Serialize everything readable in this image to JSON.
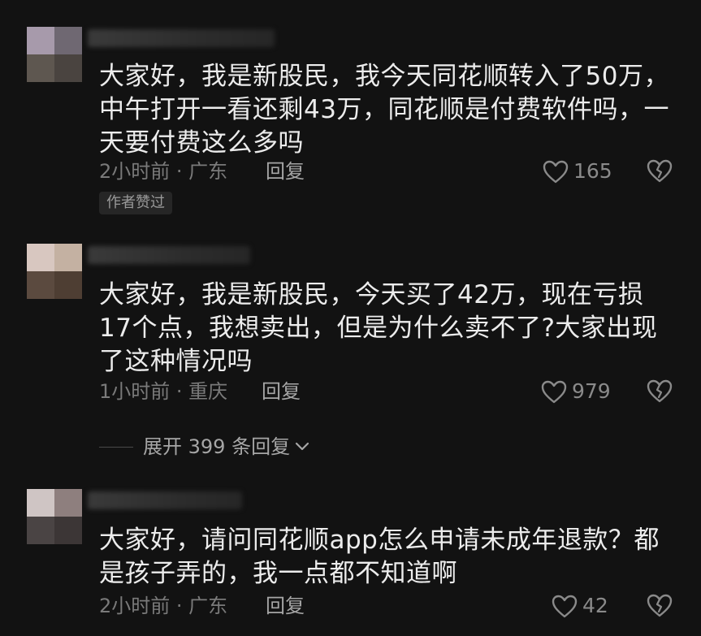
{
  "comments": [
    {
      "text": "大家好，我是新股民，我今天同花顺转入了50万，中午打开一看还剩43万，同花顺是付费软件吗，一天要付费这么多吗",
      "time_location": "2小时前 · 广东",
      "reply_label": "回复",
      "likes": "165",
      "badge": "作者赞过"
    },
    {
      "text": "大家好，我是新股民，今天买了42万，现在亏损17个点，我想卖出，但是为什么卖不了?大家出现了这种情况吗",
      "time_location": "1小时前 · 重庆",
      "reply_label": "回复",
      "likes": "979"
    },
    {
      "text": "大家好，请问同花顺app怎么申请未成年退款？都是孩子弄的，我一点都不知道啊",
      "time_location": "2小时前 · 广东",
      "reply_label": "回复",
      "likes": "42"
    }
  ],
  "expand_replies": {
    "label": "展开 399 条回复"
  },
  "icons": {
    "like": "heart-outline-icon",
    "dislike": "broken-heart-icon",
    "expand": "chevron-down-icon"
  },
  "colors": {
    "background": "#121212",
    "text": "#ececec",
    "meta": "#7a7a7a",
    "action": "#a6a6a6"
  }
}
